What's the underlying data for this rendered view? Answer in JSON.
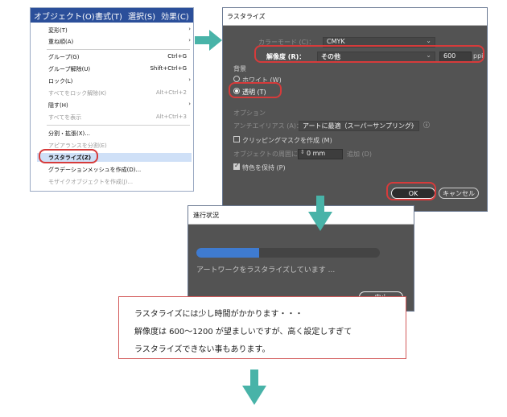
{
  "colors": {
    "accent_arrow": "#48b3a8",
    "highlight_ring": "#d63b3b",
    "menubar": "#2b4f9a",
    "dialog_bg": "#535353"
  },
  "menu": {
    "bar": [
      "オブジェクト(O)",
      "書式(T)",
      "選択(S)",
      "効果(C)"
    ],
    "items": [
      {
        "label": "変形(T)",
        "shortcut": "",
        "submenu": true,
        "disabled": false
      },
      {
        "label": "重ね順(A)",
        "shortcut": "",
        "submenu": true,
        "disabled": false
      },
      {
        "label": "グループ(G)",
        "shortcut": "Ctrl+G",
        "submenu": false,
        "disabled": false
      },
      {
        "label": "グループ解除(U)",
        "shortcut": "Shift+Ctrl+G",
        "submenu": false,
        "disabled": false
      },
      {
        "label": "ロック(L)",
        "shortcut": "",
        "submenu": true,
        "disabled": false
      },
      {
        "label": "すべてをロック解除(K)",
        "shortcut": "Alt+Ctrl+2",
        "submenu": false,
        "disabled": true
      },
      {
        "label": "隠す(H)",
        "shortcut": "",
        "submenu": true,
        "disabled": false
      },
      {
        "label": "すべてを表示",
        "shortcut": "Alt+Ctrl+3",
        "submenu": false,
        "disabled": true
      },
      {
        "label": "分割・拡張(X)...",
        "shortcut": "",
        "submenu": false,
        "disabled": false
      },
      {
        "label": "アピアランスを分割(E)",
        "shortcut": "",
        "submenu": false,
        "disabled": true
      },
      {
        "label": "ラスタライズ(Z)",
        "shortcut": "",
        "submenu": false,
        "disabled": false
      },
      {
        "label": "グラデーションメッシュを作成(D)...",
        "shortcut": "",
        "submenu": false,
        "disabled": false
      },
      {
        "label": "モザイクオブジェクトを作成(J)...",
        "shortcut": "",
        "submenu": false,
        "disabled": true
      }
    ]
  },
  "rasterize_dialog": {
    "title": "ラスタライズ",
    "color_mode_label": "カラーモード (C)：",
    "color_mode_value": "CMYK",
    "resolution_label": "解像度 (R)：",
    "resolution_value": "その他",
    "resolution_number": "600",
    "resolution_unit": "ppi",
    "background_label": "背景",
    "bg_white": "ホワイト (W)",
    "bg_transparent": "透明 (T)",
    "options_label": "オプション",
    "antialias_label": "アンチエイリアス (A)：",
    "antialias_value": "アートに最適（スーパーサンプリング）",
    "clipping_mask": "クリッピングマスクを作成 (M)",
    "around_object_label": "オブジェクトの周囲に",
    "around_object_value": "0 mm",
    "add_label": "追加 (D)",
    "keep_spot": "特色を保持 (P)",
    "ok": "OK",
    "cancel": "キャンセル"
  },
  "progress_dialog": {
    "title": "進行状況",
    "message": "アートワークをラスタライズしています ...",
    "progress": 0.34,
    "stop_button": "中止"
  },
  "note": {
    "line1": "ラスタライズには少し時間がかかります・・・",
    "line2": "解像度は 600〜1200 が望ましいですが、高く設定しすぎて",
    "line3": "ラスタライズできない事もあります。"
  }
}
